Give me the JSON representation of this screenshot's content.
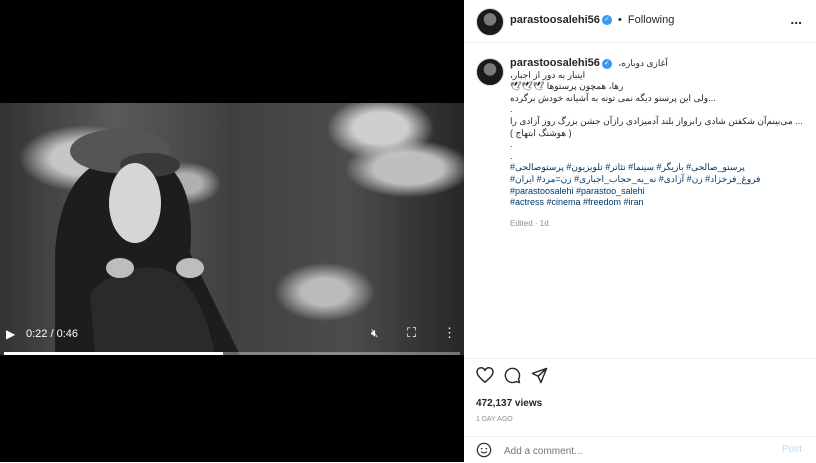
{
  "video": {
    "time": "0:22 / 0:46",
    "progress": 0.48,
    "icons": [
      "play-icon",
      "mute-icon",
      "fullscreen-icon",
      "more-vertical-icon"
    ]
  },
  "header": {
    "username": "parastoosalehi56",
    "separator": "•",
    "following": "Following",
    "more": "..."
  },
  "caption": {
    "username": "parastoosalehi56",
    "lines": [
      "آغازی دوباره،",
      "اینبار به دور از اجبار،",
      "رها، همچون پرستوها 🕊🕊🕊",
      "...ولی این پرستو دیگه نمی تونه به آشیانه خودش برگرده",
      ".",
      "... می‌بینم‌آن شکفتن شادی رابرواز بلند آدمیزادی رازآن جشن بزرگ روز آزادی را",
      "( هوشنگ ابتهاج )",
      ".",
      "."
    ],
    "tags_fa_1": "پرستو_صالحی# بازیگر# سینما# تئاتر# تلویزیون# پرستوصالحی#",
    "tags_fa_2": "فروغ_فرخزاد# زن# آزادی# نه_به_حجاب_اجباری# زن=مرد# ایران#",
    "tags_en_1": "#parastoosalehi #parastoo_salehi",
    "tags_en_2": "#actress #cinema #freedom #iran",
    "edited": "Edited · 1d"
  },
  "stats": {
    "views": "472,137 views",
    "date": "1 DAY AGO"
  },
  "comment": {
    "placeholder": "Add a comment...",
    "post": "Post"
  }
}
